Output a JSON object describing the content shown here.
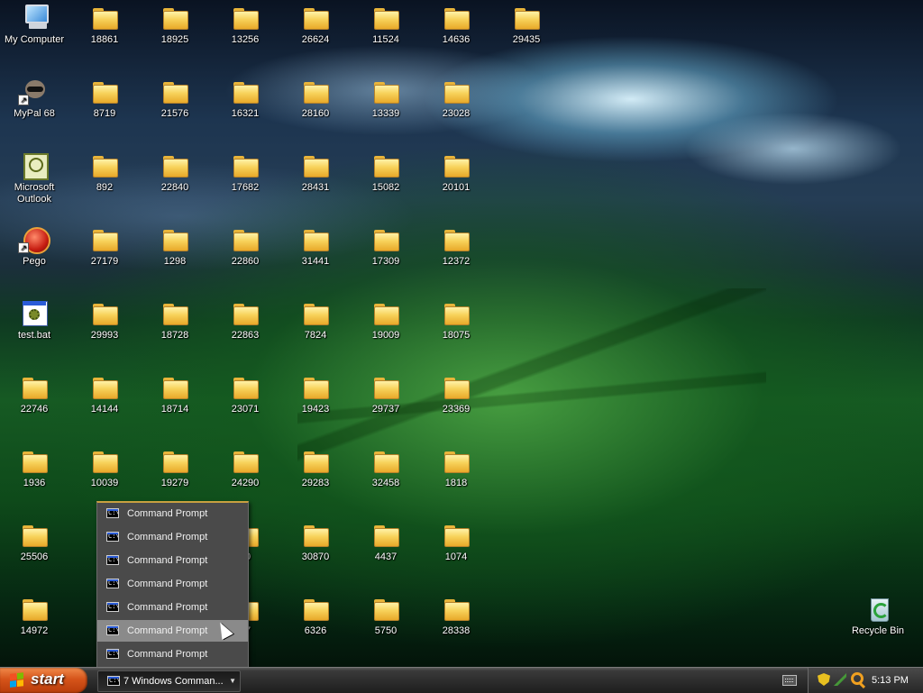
{
  "desktop": {
    "system_icons": [
      {
        "name": "my-computer",
        "label": "My Computer",
        "glyph": "computer-icon"
      },
      {
        "name": "mypal-68",
        "label": "MyPal 68",
        "glyph": "mypal-icon"
      },
      {
        "name": "microsoft-outlook",
        "label": "Microsoft Outlook",
        "glyph": "outlook-icon"
      },
      {
        "name": "pego",
        "label": "Pego",
        "glyph": "pego-icon"
      },
      {
        "name": "test-bat",
        "label": "test.bat",
        "glyph": "batch-file-icon"
      },
      {
        "name": "recycle-bin",
        "label": "Recycle Bin",
        "glyph": "recycle-bin-icon"
      }
    ],
    "folders": [
      {
        "label": "18861"
      },
      {
        "label": "18925"
      },
      {
        "label": "13256"
      },
      {
        "label": "26624"
      },
      {
        "label": "11524"
      },
      {
        "label": "14636"
      },
      {
        "label": "29435"
      },
      {
        "label": "8719"
      },
      {
        "label": "21576"
      },
      {
        "label": "16321"
      },
      {
        "label": "28160"
      },
      {
        "label": "13339"
      },
      {
        "label": "23028"
      },
      {
        "label": "892"
      },
      {
        "label": "22840"
      },
      {
        "label": "17682"
      },
      {
        "label": "28431"
      },
      {
        "label": "15082"
      },
      {
        "label": "20101"
      },
      {
        "label": "27179"
      },
      {
        "label": "1298"
      },
      {
        "label": "22860"
      },
      {
        "label": "31441"
      },
      {
        "label": "17309"
      },
      {
        "label": "12372"
      },
      {
        "label": "29993"
      },
      {
        "label": "18728"
      },
      {
        "label": "22863"
      },
      {
        "label": "7824"
      },
      {
        "label": "19009"
      },
      {
        "label": "18075"
      },
      {
        "label": "22746"
      },
      {
        "label": "14144"
      },
      {
        "label": "18714"
      },
      {
        "label": "23071"
      },
      {
        "label": "19423"
      },
      {
        "label": "29737"
      },
      {
        "label": "23369"
      },
      {
        "label": "1936"
      },
      {
        "label": "10039"
      },
      {
        "label": "19279"
      },
      {
        "label": "24290"
      },
      {
        "label": "29283"
      },
      {
        "label": "32458"
      },
      {
        "label": "1818"
      },
      {
        "label": "25506"
      },
      {
        "label": "30870"
      },
      {
        "label": "4437"
      },
      {
        "label": "1074"
      },
      {
        "label": "14972"
      },
      {
        "label": "6326"
      },
      {
        "label": "5750"
      },
      {
        "label": "28338"
      }
    ]
  },
  "group_menu": {
    "items": [
      {
        "label": "Command Prompt",
        "icon": "command-prompt-icon",
        "hover": false
      },
      {
        "label": "Command Prompt",
        "icon": "command-prompt-icon",
        "hover": false
      },
      {
        "label": "Command Prompt",
        "icon": "command-prompt-icon",
        "hover": false
      },
      {
        "label": "Command Prompt",
        "icon": "command-prompt-icon",
        "hover": false
      },
      {
        "label": "Command Prompt",
        "icon": "command-prompt-icon",
        "hover": false
      },
      {
        "label": "Command Prompt",
        "icon": "command-prompt-icon",
        "hover": true
      },
      {
        "label": "Command Prompt",
        "icon": "command-prompt-icon",
        "hover": false
      }
    ]
  },
  "taskbar": {
    "start_label": "start",
    "task_group_label": "7 Windows Comman...",
    "clock": "5:13 PM",
    "tray_icons": [
      "keyboard-icon",
      "security-shield-icon",
      "network-icon",
      "search-icon"
    ],
    "colors": {
      "start_button": "#d6541a",
      "taskbar": "#2c2c2c",
      "menu_bg": "#4a4a4a",
      "menu_hover": "#8a8a8a"
    }
  }
}
